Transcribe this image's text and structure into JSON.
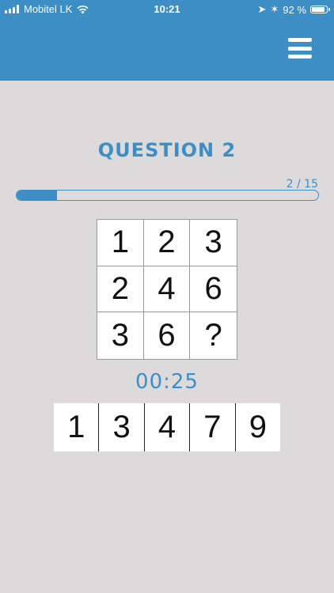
{
  "status_bar": {
    "carrier": "Mobitel LK",
    "time": "10:21",
    "battery": "92 %",
    "battery_level": 0.92
  },
  "header": {
    "menu_icon": "hamburger-menu-icon",
    "bg_color": "#3d8ec5"
  },
  "question": {
    "title": "QUESTION 2",
    "progress_text": "2 / 15",
    "progress_current": 2,
    "progress_total": 15
  },
  "grid": {
    "cells": [
      "1",
      "2",
      "3",
      "2",
      "4",
      "6",
      "3",
      "6",
      "?"
    ]
  },
  "timer": "00:25",
  "answers": [
    "1",
    "3",
    "4",
    "7",
    "9"
  ],
  "colors": {
    "accent": "#3d8ec5",
    "background": "#dcdadb"
  }
}
